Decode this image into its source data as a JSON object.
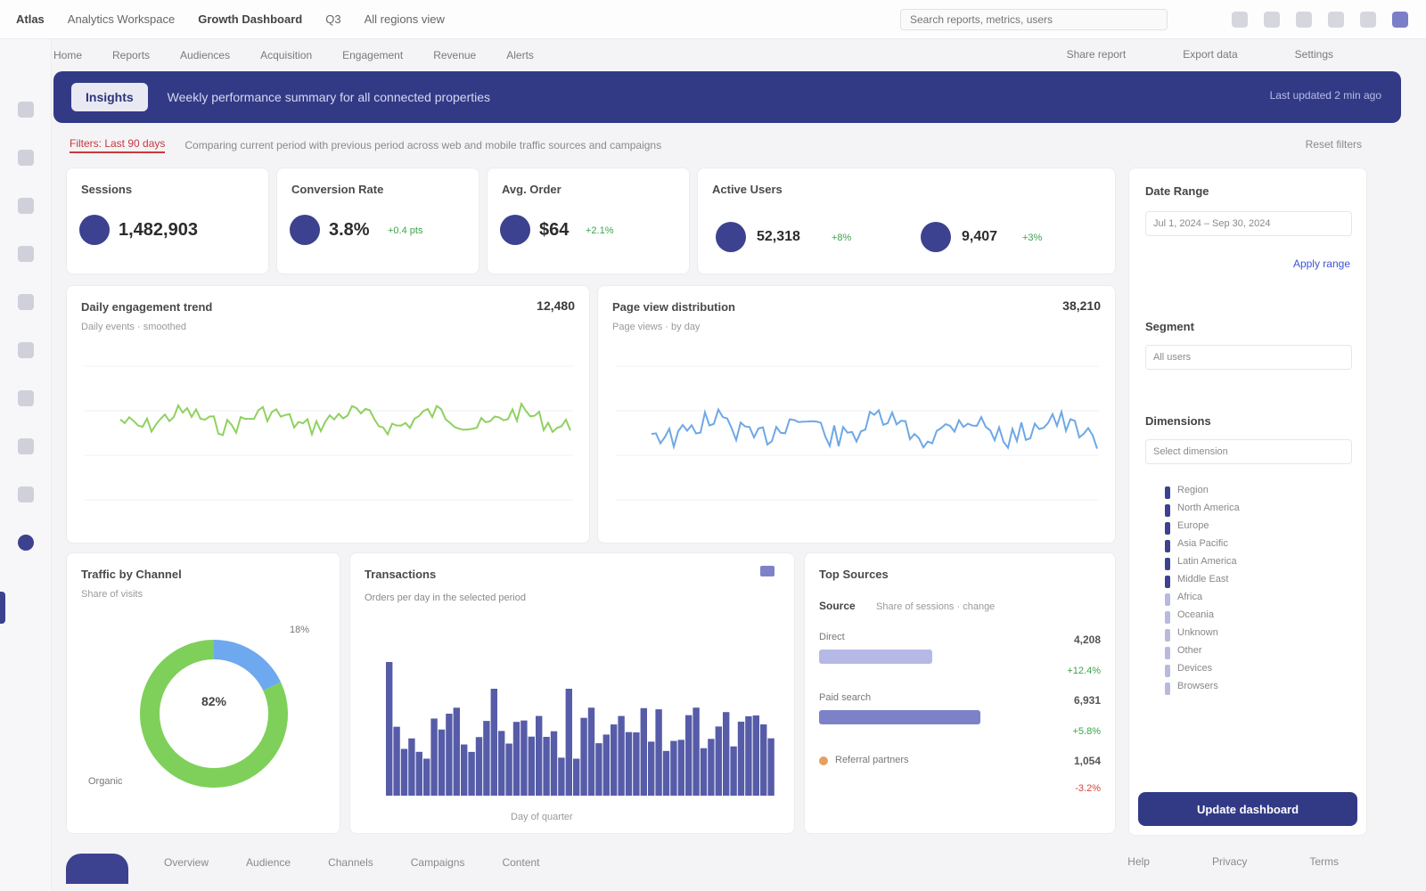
{
  "topbar": {
    "app": "Atlas",
    "crumbs": [
      "Analytics Workspace",
      "Growth Dashboard",
      "Q3",
      "All regions view"
    ],
    "search_placeholder": "Search reports, metrics, users"
  },
  "subnav": {
    "items": [
      "Home",
      "Reports",
      "Audiences",
      "Acquisition",
      "Engagement",
      "Revenue",
      "Alerts"
    ],
    "right": [
      "Share report",
      "Export data",
      "Settings"
    ]
  },
  "banner": {
    "badge": "Insights",
    "text": "Weekly performance summary for all connected properties",
    "right": "Last updated 2 min ago"
  },
  "filter": {
    "accent": "Filters: Last 90 days",
    "desc": "Comparing current period with previous period across web and mobile traffic sources and campaigns",
    "right": "Reset filters"
  },
  "kpis": [
    {
      "title": "Sessions",
      "value": "1,482,903",
      "delta": ""
    },
    {
      "title": "Conversion Rate",
      "value": "3.8%",
      "delta": "+0.4 pts"
    },
    {
      "title": "Avg. Order",
      "value": "$64",
      "delta": "+2.1%"
    }
  ],
  "users_card": {
    "title": "Active Users",
    "items": [
      {
        "value": "52,318",
        "delta": "+8%"
      },
      {
        "value": "9,407",
        "delta": "+3%"
      }
    ]
  },
  "line_left": {
    "title": "Daily engagement trend",
    "sub": "Daily events · smoothed",
    "total": "12,480",
    "color": "#8fd160"
  },
  "line_right": {
    "title": "Page view distribution",
    "sub": "Page views · by day",
    "total": "38,210",
    "color": "#6ea8e6"
  },
  "donut": {
    "title": "Traffic by Channel",
    "sub": "Share of visits",
    "center": "82%",
    "label_top": "18%",
    "label_bottom": "Organic",
    "slices": [
      {
        "value": 82,
        "color": "#7fd05a"
      },
      {
        "value": 18,
        "color": "#6ea8ee"
      }
    ]
  },
  "histogram": {
    "title": "Transactions",
    "legend": "Orders per day in the selected period",
    "sub": "Day of quarter",
    "color": "#565ca8"
  },
  "top_sources": {
    "title": "Top Sources",
    "header": "Source",
    "header_sub": "Share of sessions · change",
    "rows": [
      {
        "label": "Direct",
        "value": "4,208",
        "delta": "+12.4%",
        "delta_color": "#3ca44a",
        "fill": 0.4,
        "color": "#b6b9e6"
      },
      {
        "label": "Paid search",
        "value": "6,931",
        "delta": "+5.8%",
        "delta_color": "#3ca44a",
        "fill": 0.57,
        "color": "#7d82c8"
      },
      {
        "label": "Referral partners",
        "value": "1,054",
        "delta": "-3.2%",
        "delta_color": "#d4453f",
        "fill": 0.0,
        "color": "#e7a060"
      }
    ]
  },
  "right_panel": {
    "title1": "Date Range",
    "field1": "Jul 1, 2024 – Sep 30, 2024",
    "link": "Apply range",
    "title2": "Segment",
    "field2": "All users",
    "title3": "Dimensions",
    "field3": "Select dimension",
    "tree": [
      "Region",
      "North America",
      "Europe",
      "Asia Pacific",
      "Latin America",
      "Middle East",
      "Africa",
      "Oceania",
      "Unknown",
      "Other",
      "Devices",
      "Browsers"
    ],
    "button": "Update dashboard"
  },
  "footer": {
    "items": [
      "Overview",
      "Audience",
      "Channels",
      "Campaigns",
      "Content"
    ],
    "right": [
      "Help",
      "Privacy",
      "Terms"
    ]
  }
}
